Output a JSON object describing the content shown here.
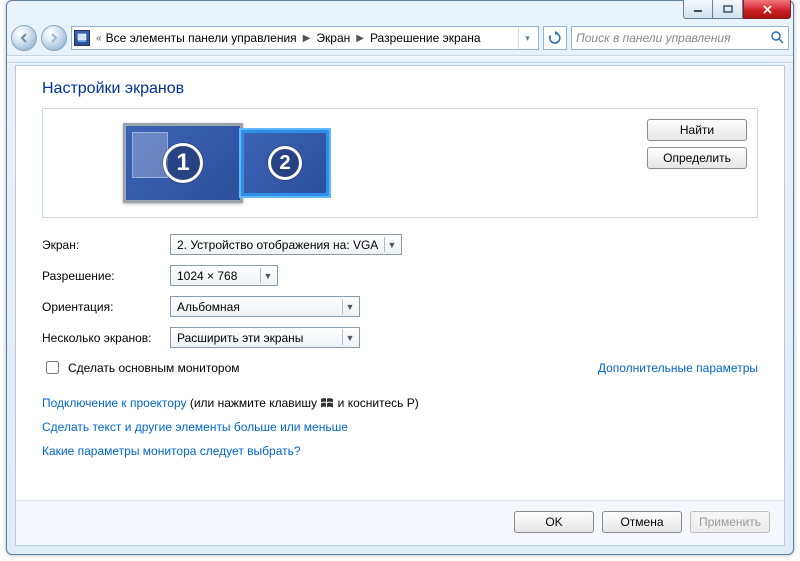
{
  "window": {
    "breadcrumb": [
      "Все элементы панели управления",
      "Экран",
      "Разрешение экрана"
    ],
    "search_placeholder": "Поиск в панели управления"
  },
  "page": {
    "title": "Настройки экранов",
    "side_buttons": {
      "find": "Найти",
      "identify": "Определить"
    },
    "monitors": [
      {
        "num": "1",
        "selected": false
      },
      {
        "num": "2",
        "selected": true
      }
    ],
    "labels": {
      "display": "Экран:",
      "resolution": "Разрешение:",
      "orientation": "Ориентация:",
      "multi": "Несколько экранов:",
      "make_main": "Сделать основным монитором",
      "adv": "Дополнительные параметры",
      "proj_link": "Подключение к проектору",
      "proj_rest_a": " (или нажмите клавишу ",
      "proj_rest_b": " и коснитесь P)",
      "text_size": "Сделать текст и другие элементы больше или меньше",
      "which": "Какие параметры монитора следует выбрать?"
    },
    "values": {
      "display": "2. Устройство отображения на: VGA",
      "resolution": "1024 × 768",
      "orientation": "Альбомная",
      "multi": "Расширить эти экраны"
    },
    "footer": {
      "ok": "OK",
      "cancel": "Отмена",
      "apply": "Применить"
    }
  }
}
